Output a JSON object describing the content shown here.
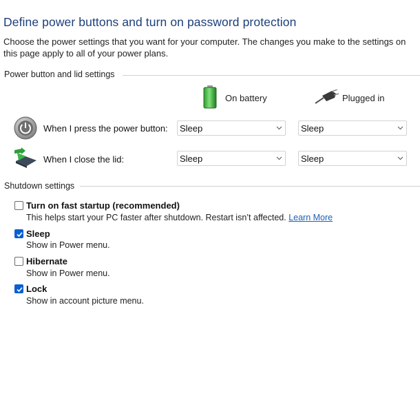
{
  "page": {
    "title": "Define power buttons and turn on password protection",
    "intro": "Choose the power settings that you want for your computer. The changes you make to the settings on this page apply to all of your power plans."
  },
  "power_section": {
    "heading": "Power button and lid settings",
    "columns": {
      "battery": "On battery",
      "plugged": "Plugged in"
    },
    "column_icons": {
      "battery": "battery-icon",
      "plugged": "power-plug-icon"
    },
    "rows": [
      {
        "label": "When I press the power button:",
        "icon": "power-button-icon",
        "battery": "Sleep",
        "plugged": "Sleep"
      },
      {
        "label": "When I close the lid:",
        "icon": "laptop-lid-icon",
        "battery": "Sleep",
        "plugged": "Sleep"
      }
    ]
  },
  "shutdown_section": {
    "heading": "Shutdown settings",
    "options": [
      {
        "label": "Turn on fast startup (recommended)",
        "description": "This helps start your PC faster after shutdown. Restart isn’t affected.",
        "link": "Learn More",
        "checked": false
      },
      {
        "label": "Sleep",
        "description": "Show in Power menu.",
        "checked": true
      },
      {
        "label": "Hibernate",
        "description": "Show in Power menu.",
        "checked": false
      },
      {
        "label": "Lock",
        "description": "Show in account picture menu.",
        "checked": true
      }
    ]
  },
  "colors": {
    "title": "#1c3f7a",
    "checkbox_checked": "#0a5fd1",
    "link": "#1a5fb4"
  }
}
